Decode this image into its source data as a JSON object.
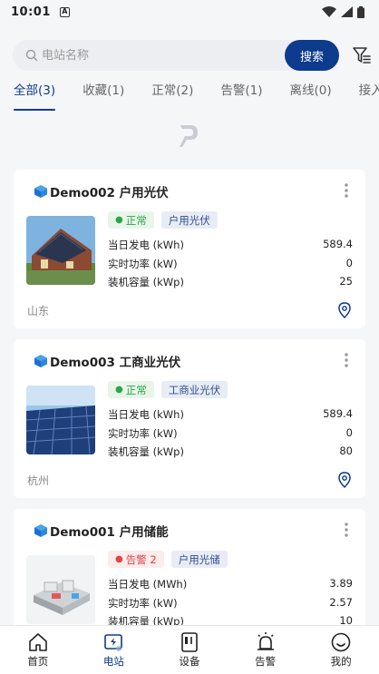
{
  "status_bar": {
    "time": "10:01",
    "notification_glyph": "A"
  },
  "search": {
    "placeholder": "电站名称",
    "button_label": "搜索"
  },
  "tabs": [
    {
      "label": "全部(3)",
      "active": true
    },
    {
      "label": "收藏(1)"
    },
    {
      "label": "正常(2)"
    },
    {
      "label": "告警(1)"
    },
    {
      "label": "离线(0)"
    },
    {
      "label": "接入中("
    }
  ],
  "stations": [
    {
      "name": "Demo002 户用光伏",
      "status": "正常",
      "type": "户用光伏",
      "metrics": [
        {
          "label": "当日发电 (kWh)",
          "value": "589.4"
        },
        {
          "label": "实时功率 (kW)",
          "value": "0"
        },
        {
          "label": "装机容量 (kWp)",
          "value": "25"
        }
      ],
      "location": "山东"
    },
    {
      "name": "Demo003 工商业光伏",
      "status": "正常",
      "type": "工商业光伏",
      "metrics": [
        {
          "label": "当日发电 (kWh)",
          "value": "589.4"
        },
        {
          "label": "实时功率 (kW)",
          "value": "0"
        },
        {
          "label": "装机容量 (kWp)",
          "value": "80"
        }
      ],
      "location": "杭州"
    },
    {
      "name": "Demo001 户用储能",
      "status": "告警 2",
      "type": "户用光储",
      "metrics": [
        {
          "label": "当日发电 (MWh)",
          "value": "3.89"
        },
        {
          "label": "实时功率 (kW)",
          "value": "2.57"
        },
        {
          "label": "装机容量 (kWp)",
          "value": "10"
        }
      ]
    }
  ],
  "bottom_nav": [
    {
      "label": "首页",
      "icon": "home-icon"
    },
    {
      "label": "电站",
      "icon": "station-icon",
      "active": true
    },
    {
      "label": "设备",
      "icon": "device-icon"
    },
    {
      "label": "告警",
      "icon": "alarm-icon"
    },
    {
      "label": "我的",
      "icon": "profile-icon"
    }
  ],
  "colors": {
    "primary": "#0d3b8e",
    "ok": "#2fa44a",
    "warn": "#e04444",
    "background": "#f5f6f8"
  }
}
